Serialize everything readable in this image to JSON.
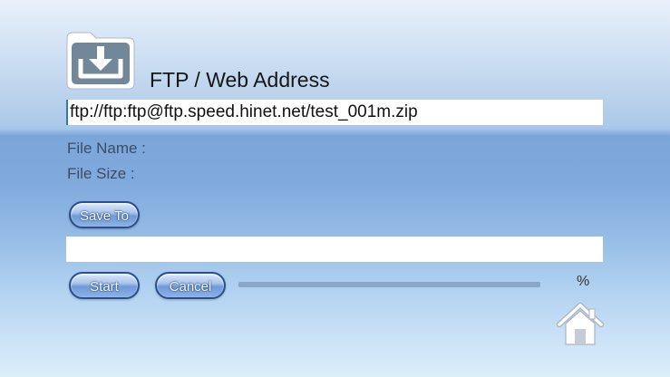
{
  "header": {
    "icon": "download-folder-icon",
    "title": "FTP / Web Address"
  },
  "address": {
    "value": "ftp://ftp:ftp@ftp.speed.hinet.net/test_001m.zip"
  },
  "file_info": {
    "name_label": "File Name :",
    "name_value": "",
    "size_label": "File Size :",
    "size_value": ""
  },
  "buttons": {
    "save_to": "Save To",
    "start": "Start",
    "cancel": "Cancel"
  },
  "save_path": {
    "value": ""
  },
  "progress": {
    "value": 0,
    "percent_label": "%"
  },
  "nav": {
    "home_icon": "home-icon"
  }
}
